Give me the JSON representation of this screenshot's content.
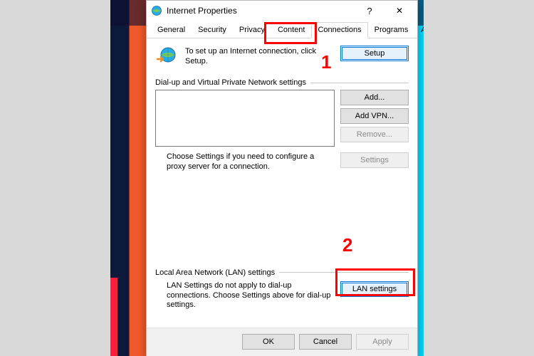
{
  "window": {
    "title": "Internet Properties",
    "help_glyph": "?",
    "close_glyph": "✕"
  },
  "tabs": {
    "general": "General",
    "security": "Security",
    "privacy": "Privacy",
    "content": "Content",
    "connections": "Connections",
    "programs": "Programs",
    "advanced": "Advanced"
  },
  "setup": {
    "text": "To set up an Internet connection, click Setup.",
    "button": "Setup"
  },
  "dialup_group": {
    "caption": "Dial-up and Virtual Private Network settings",
    "add_button": "Add...",
    "add_vpn_button": "Add VPN...",
    "remove_button": "Remove...",
    "proxy_text": "Choose Settings if you need to configure a proxy server for a connection.",
    "settings_button": "Settings"
  },
  "lan_group": {
    "caption": "Local Area Network (LAN) settings",
    "text": "LAN Settings do not apply to dial-up connections. Choose Settings above for dial-up settings.",
    "button": "LAN settings"
  },
  "footer": {
    "ok": "OK",
    "cancel": "Cancel",
    "apply": "Apply"
  },
  "annotations": {
    "num1": "1",
    "num2": "2"
  }
}
